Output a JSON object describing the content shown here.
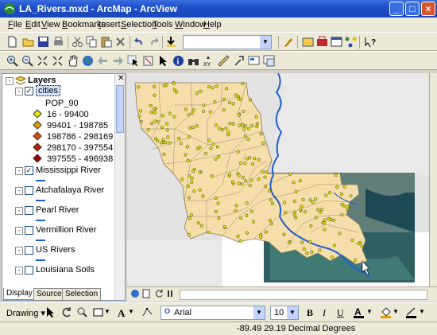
{
  "window": {
    "title": "LA_Rivers.mxd - ArcMap - ArcView"
  },
  "menu": [
    "File",
    "Edit",
    "View",
    "Bookmarks",
    "Insert",
    "Selection",
    "Tools",
    "Window",
    "Help"
  ],
  "menu_keys": [
    "F",
    "E",
    "V",
    "B",
    "I",
    "S",
    "T",
    "W",
    "H"
  ],
  "toc": {
    "root": "Layers",
    "cities": {
      "name": "cities",
      "field": "POP_90",
      "classes": [
        {
          "label": "16 - 99400",
          "color": "#e8e800"
        },
        {
          "label": "99401 - 198785",
          "color": "#e8a000"
        },
        {
          "label": "198786 - 298169",
          "color": "#e05000"
        },
        {
          "label": "298170 - 397554",
          "color": "#c02000"
        },
        {
          "label": "397555 - 496938",
          "color": "#a00000"
        }
      ]
    },
    "layers": [
      {
        "name": "Mississippi River",
        "checked": true
      },
      {
        "name": "Atchafalaya River",
        "checked": false
      },
      {
        "name": "Pearl River",
        "checked": false
      },
      {
        "name": "Vermillion River",
        "checked": false
      },
      {
        "name": "US Rivers",
        "checked": false
      },
      {
        "name": "Louisiana Soils",
        "checked": false
      }
    ],
    "tabs": [
      "Display",
      "Source",
      "Selection"
    ]
  },
  "drawing": {
    "label": "Drawing",
    "font": "Arial",
    "size": "10",
    "bold": "B",
    "italic": "I",
    "underline": "U"
  },
  "status": {
    "coords": "-89.49  29.19 Decimal Degrees"
  },
  "colors": {
    "land": "#f5deaa",
    "river": "#1f5fd0",
    "point": "#e8e800"
  }
}
